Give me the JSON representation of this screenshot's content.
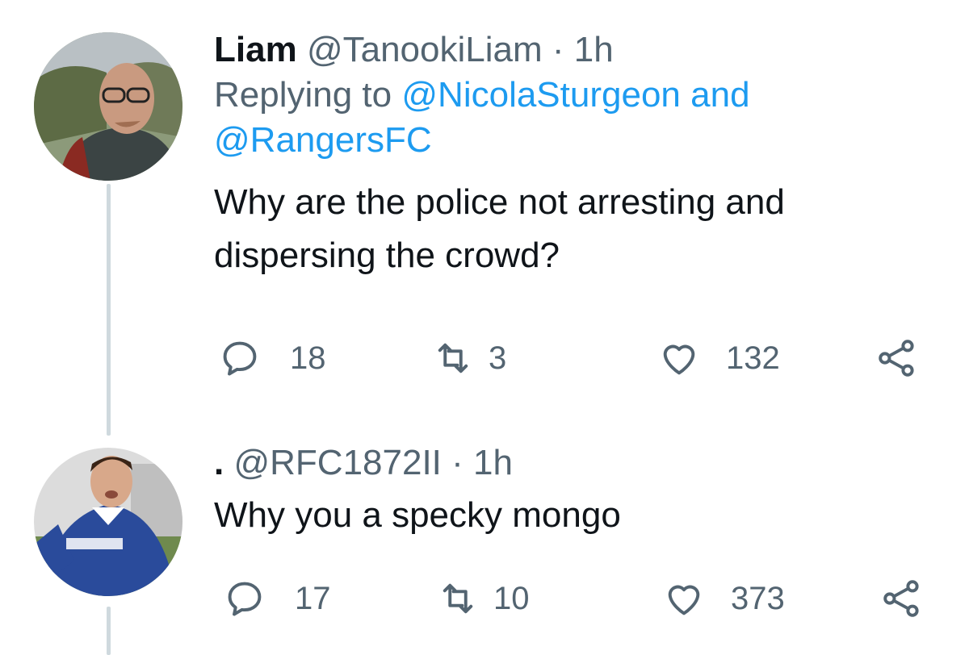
{
  "colors": {
    "text": "#0f1419",
    "secondary": "#536471",
    "link": "#1d9bf0",
    "thread_line": "#cfd9de"
  },
  "tweets": [
    {
      "name": "Liam",
      "handle": "@TanookiLiam",
      "separator": "·",
      "time": "1h",
      "replying_prefix": "Replying to",
      "mention_1": "@NicolaSturgeon",
      "replying_joiner": "and",
      "mention_2": "@RangersFC",
      "text": "Why are the police not arresting and dispersing the crowd?",
      "reply_count": "18",
      "retweet_count": "3",
      "like_count": "132",
      "icons": [
        "reply-icon",
        "retweet-icon",
        "heart-icon",
        "share-icon"
      ]
    },
    {
      "name": ".",
      "handle": "@RFC1872II",
      "separator": "·",
      "time": "1h",
      "text": "Why you a specky mongo",
      "reply_count": "17",
      "retweet_count": "10",
      "like_count": "373",
      "icons": [
        "reply-icon",
        "retweet-icon",
        "heart-icon",
        "share-icon"
      ]
    }
  ]
}
